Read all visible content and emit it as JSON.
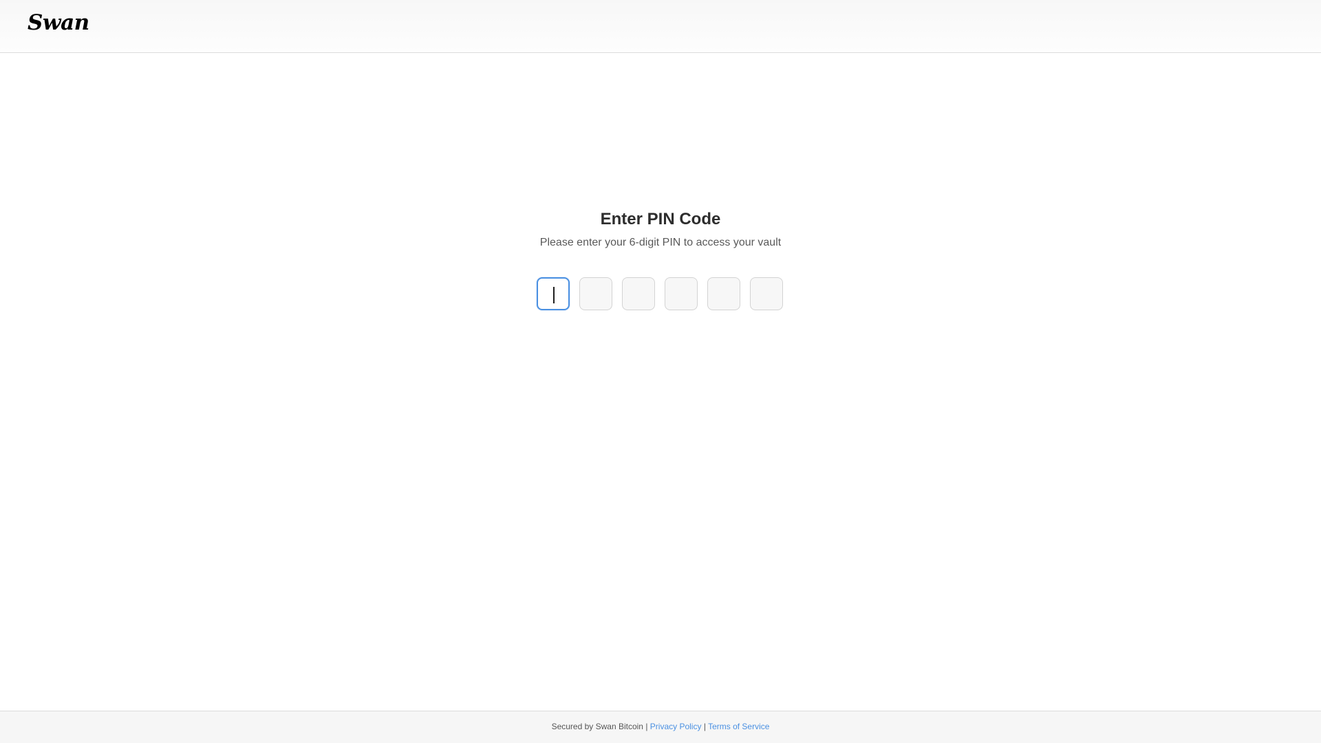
{
  "header": {
    "logo_text": "Swan"
  },
  "pin_prompt": {
    "title": "Enter PIN Code",
    "subtitle": "Please enter your 6-digit PIN to access your vault",
    "digit_count": 6,
    "active_digit_index": 0,
    "active_border_color": "#4a90e2"
  },
  "footer": {
    "secured_text": "Secured by Swan Bitcoin",
    "separator": "|",
    "privacy_label": "Privacy Policy",
    "terms_label": "Terms of Service",
    "link_color": "#4a90e2"
  }
}
